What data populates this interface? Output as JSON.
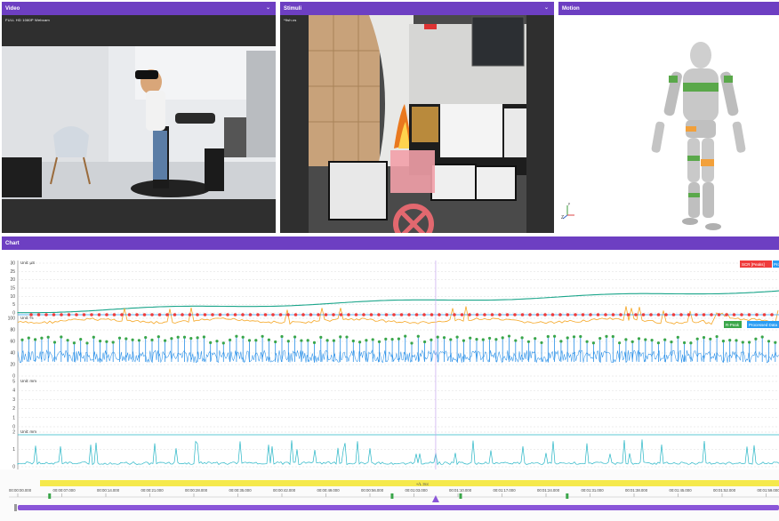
{
  "panels": {
    "video": {
      "title": "Video",
      "caption": "FULL HD 1080P Webcam"
    },
    "stimuli": {
      "title": "Stimuli",
      "caption": "*fish.cs"
    },
    "motion": {
      "title": "Motion",
      "axis_z": "Z",
      "axis_y": "y"
    },
    "chart": {
      "title": "Chart"
    }
  },
  "colors": {
    "header": "#6d3fc2",
    "scr": "#ef3b3b",
    "processed": "#2a9df4",
    "hr": "#1aa58a",
    "ibi_peak": "#3aa64a",
    "ppg": "#2a90e8",
    "orange": "#f5a623",
    "yellow": "#f5e94c",
    "playhead": "#8a56d8",
    "teal": "#28b6c6"
  },
  "chart_data": {
    "type": "line",
    "subplots": [
      {
        "ylabel": "Unit: µS",
        "ticks": [
          "30",
          "25",
          "20",
          "15",
          "10",
          "5",
          "0"
        ],
        "legend": [
          "SCR [Peaks]",
          "Pro"
        ],
        "series": [
          {
            "name": "SCR [Peaks]",
            "style": "markers",
            "y_approx": 10.5
          },
          {
            "name": "Pro",
            "style": "line"
          }
        ]
      },
      {
        "ylabel": "Unit: %",
        "ticks": [
          "100",
          "80",
          "60",
          "40",
          "20",
          "0"
        ],
        "legend": [
          "R-Peak",
          "Processed Data"
        ],
        "series": [
          {
            "name": "Processed Data",
            "y_range": [
              20,
              80
            ]
          }
        ]
      },
      {
        "ylabel": "Unit: mm",
        "ticks": [
          "5",
          "4",
          "3",
          "2",
          "1",
          "0"
        ],
        "series": []
      },
      {
        "ylabel": "Unit: mm",
        "ticks": [
          "2",
          "1",
          "0"
        ],
        "series": [
          {
            "style": "spikes",
            "baseline": 0.4
          }
        ]
      }
    ]
  },
  "timeline": {
    "range_label": "+/L 3cc",
    "ticks": [
      "00:00:00.000",
      "00:00:07.000",
      "00:00:14.000",
      "00:00:21.000",
      "00:00:28.000",
      "00:00:35.000",
      "00:00:42.000",
      "00:00:49.000",
      "00:00:56.000",
      "00:01:03.000",
      "00:01:10.000",
      "00:01:17.000",
      "00:01:24.000",
      "00:01:31.000",
      "00:01:38.000",
      "00:01:45.000",
      "00:01:52.000",
      "00:01:59.000"
    ],
    "marker_positions": [
      0.04,
      0.49,
      0.58,
      0.72
    ],
    "playhead_fraction": 0.61
  }
}
